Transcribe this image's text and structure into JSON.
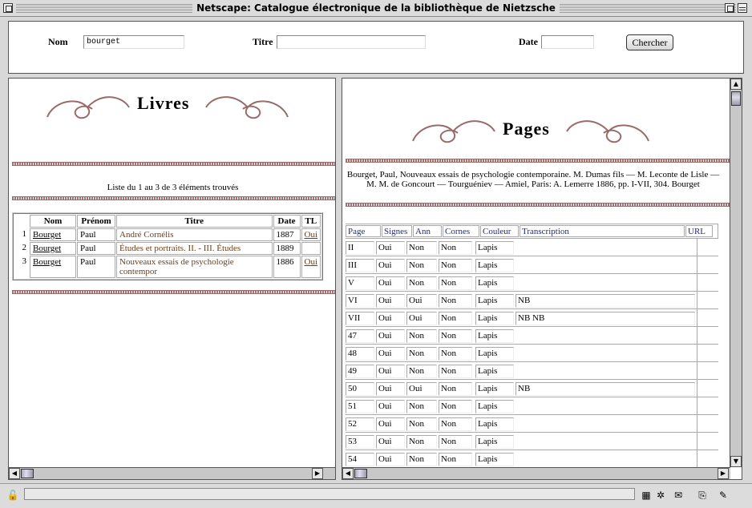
{
  "window": {
    "title": "Netscape: Catalogue électronique de la bibliothèque de Nietzsche"
  },
  "search": {
    "nom_label": "Nom",
    "nom_value": "bourget",
    "titre_label": "Titre",
    "titre_value": "",
    "date_label": "Date",
    "date_value": "",
    "button_label": "Chercher"
  },
  "left": {
    "heading": "Livres",
    "count_text": "Liste du 1 au 3 de 3 éléments trouvés",
    "columns": [
      "Nom",
      "Prénom",
      "Titre",
      "Date",
      "TL"
    ],
    "rows": [
      {
        "n": "1",
        "nom": "Bourget",
        "prenom": "Paul",
        "titre": "André Cornélis",
        "date": "1887",
        "tl": "Oui"
      },
      {
        "n": "2",
        "nom": "Bourget",
        "prenom": "Paul",
        "titre": "Études et portraits. II. - III. Études",
        "date": "1889",
        "tl": ""
      },
      {
        "n": "3",
        "nom": "Bourget",
        "prenom": "Paul",
        "titre": "Nouveaux essais de psychologie contempor",
        "date": "1886",
        "tl": "Oui"
      }
    ]
  },
  "right": {
    "heading": "Pages",
    "reference": "Bourget, Paul, Nouveaux essais de psychologie contemporaine. M. Dumas fils — M. Leconte de Lisle — M. M. de Goncourt — Tourguéniev — Amiel, Paris: A. Lemerre 1886, pp. I-VII, 304. Bourget",
    "columns": [
      "Page",
      "Signes",
      "Ann",
      "Cornes",
      "Couleur",
      "Transcription",
      "URL"
    ],
    "rows": [
      {
        "page": "II",
        "signes": "Oui",
        "ann": "Non",
        "cornes": "Non",
        "couleur": "Lapis",
        "transcription": ""
      },
      {
        "page": "III",
        "signes": "Oui",
        "ann": "Non",
        "cornes": "Non",
        "couleur": "Lapis",
        "transcription": ""
      },
      {
        "page": "V",
        "signes": "Oui",
        "ann": "Non",
        "cornes": "Non",
        "couleur": "Lapis",
        "transcription": ""
      },
      {
        "page": "VI",
        "signes": "Oui",
        "ann": "Oui",
        "cornes": "Non",
        "couleur": "Lapis",
        "transcription": "NB"
      },
      {
        "page": "VII",
        "signes": "Oui",
        "ann": "Oui",
        "cornes": "Non",
        "couleur": "Lapis",
        "transcription": "NB NB"
      },
      {
        "page": "47",
        "signes": "Oui",
        "ann": "Non",
        "cornes": "Non",
        "couleur": "Lapis",
        "transcription": ""
      },
      {
        "page": "48",
        "signes": "Oui",
        "ann": "Non",
        "cornes": "Non",
        "couleur": "Lapis",
        "transcription": ""
      },
      {
        "page": "49",
        "signes": "Oui",
        "ann": "Non",
        "cornes": "Non",
        "couleur": "Lapis",
        "transcription": ""
      },
      {
        "page": "50",
        "signes": "Oui",
        "ann": "Oui",
        "cornes": "Non",
        "couleur": "Lapis",
        "transcription": "NB"
      },
      {
        "page": "51",
        "signes": "Oui",
        "ann": "Non",
        "cornes": "Non",
        "couleur": "Lapis",
        "transcription": ""
      },
      {
        "page": "52",
        "signes": "Oui",
        "ann": "Non",
        "cornes": "Non",
        "couleur": "Lapis",
        "transcription": ""
      },
      {
        "page": "53",
        "signes": "Oui",
        "ann": "Non",
        "cornes": "Non",
        "couleur": "Lapis",
        "transcription": ""
      },
      {
        "page": "54",
        "signes": "Oui",
        "ann": "Non",
        "cornes": "Non",
        "couleur": "Lapis",
        "transcription": ""
      }
    ]
  },
  "colors": {
    "ornament": "#9a6b6b",
    "link_header": "#1d2a8a",
    "title_brown": "#6b3d1a"
  },
  "icons": {
    "status_left": "lock-icon",
    "status_right": [
      "component-bar-icon",
      "security-icon",
      "mail-icon",
      "composer-icon",
      "pen-icon"
    ]
  }
}
